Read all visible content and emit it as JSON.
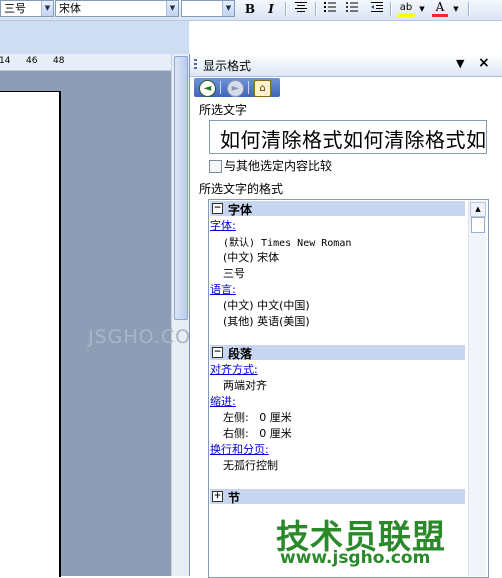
{
  "toolbar": {
    "style_value": "三号",
    "font_value": "宋体",
    "size_value": "",
    "bold_label": "B",
    "italic_label": "I",
    "align_icon": "align-center-icon",
    "list_icon": "numbered-list-icon",
    "bullet_icon": "bullet-list-icon",
    "highlight_icon": "highlight-icon",
    "font_color_label": "A",
    "font_color": "#e03020",
    "highlight_color": "#ffff00"
  },
  "ruler": {
    "ticks": [
      "14",
      "46",
      "48"
    ]
  },
  "task_pane": {
    "title": "显示格式",
    "selected_text_label": "所选文字",
    "sample_text": "如何清除格式如何清除格式如",
    "compare_checkbox_label": "与其他选定内容比较",
    "compare_checked": false,
    "format_label": "所选文字的格式",
    "sections": {
      "font": {
        "title": "字体",
        "expander": "−",
        "font_link": "字体:",
        "font_default": "(默认) Times New Roman",
        "font_chinese": "(中文) 宋体",
        "font_size": "三号",
        "language_link": "语言:",
        "lang_chinese": "(中文) 中文(中国)",
        "lang_other": "(其他) 英语(美国)"
      },
      "paragraph": {
        "title": "段落",
        "expander": "−",
        "align_link": "对齐方式:",
        "align_value": "两端对齐",
        "indent_link": "缩进:",
        "indent_left": "左侧:   0 厘米",
        "indent_right": "右侧:   0 厘米",
        "line_break_link": "换行和分页:",
        "line_break_value": "无孤行控制"
      },
      "section": {
        "title": "节",
        "expander": "+"
      }
    }
  },
  "watermark": {
    "text": "JSGHO.COM"
  },
  "brand": {
    "logo": "技术员联盟",
    "url": "www.jsgho.com",
    "color": "#2a8a2a"
  }
}
